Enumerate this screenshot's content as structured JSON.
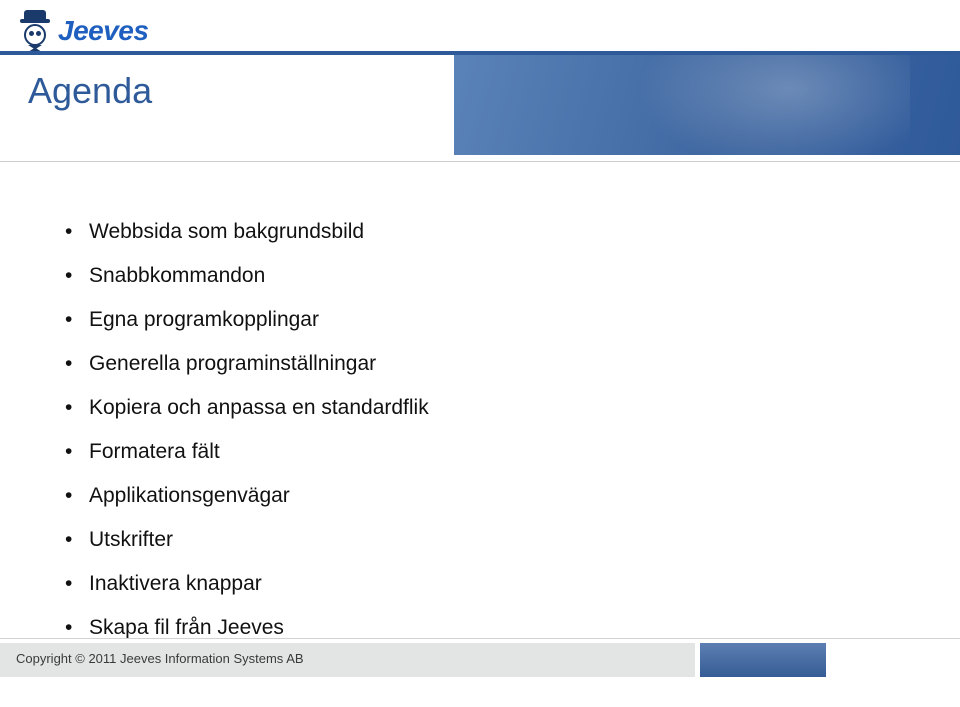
{
  "brand": {
    "name": "Jeeves"
  },
  "title": "Agenda",
  "bullets": [
    "Webbsida som bakgrundsbild",
    "Snabbkommandon",
    "Egna programkopplingar",
    "Generella programinställningar",
    "Kopiera och anpassa en standardflik",
    "Formatera fält",
    "Applikationsgenvägar",
    "Utskrifter",
    "Inaktivera knappar",
    "Skapa fil från Jeeves"
  ],
  "footer": {
    "copyright": "Copyright © 2011 Jeeves Information Systems AB"
  }
}
